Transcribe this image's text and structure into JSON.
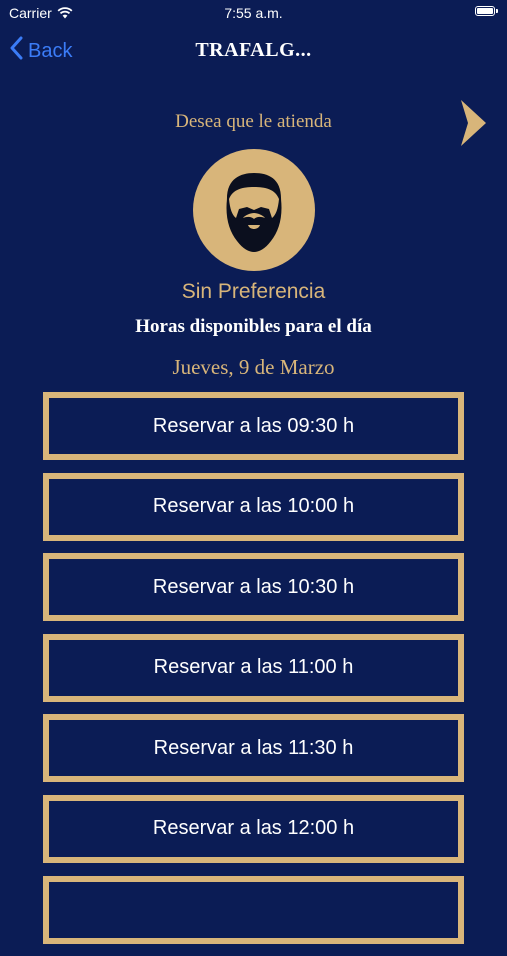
{
  "status_bar": {
    "carrier": "Carrier",
    "time": "7:55 a.m."
  },
  "nav": {
    "back_label": "Back",
    "title": "TRAFALG..."
  },
  "prompt": "Desea que le atienda",
  "barber": {
    "name": "Sin Preferencia"
  },
  "hours_title": "Horas disponibles para el día",
  "date": "Jueves, 9 de Marzo",
  "slots": [
    "Reservar a las 09:30 h",
    "Reservar a las 10:00 h",
    "Reservar a las 10:30 h",
    "Reservar a las 11:00 h",
    "Reservar a las 11:30 h",
    "Reservar a las 12:00 h",
    ""
  ],
  "colors": {
    "background": "#0b1c55",
    "gold": "#d8b57a",
    "ios_blue": "#3b7cf7"
  },
  "icons": {
    "wifi": "wifi-icon",
    "battery": "battery-icon",
    "back": "chevron-left-icon",
    "next": "chevron-right-icon",
    "avatar": "bearded-man-icon"
  }
}
